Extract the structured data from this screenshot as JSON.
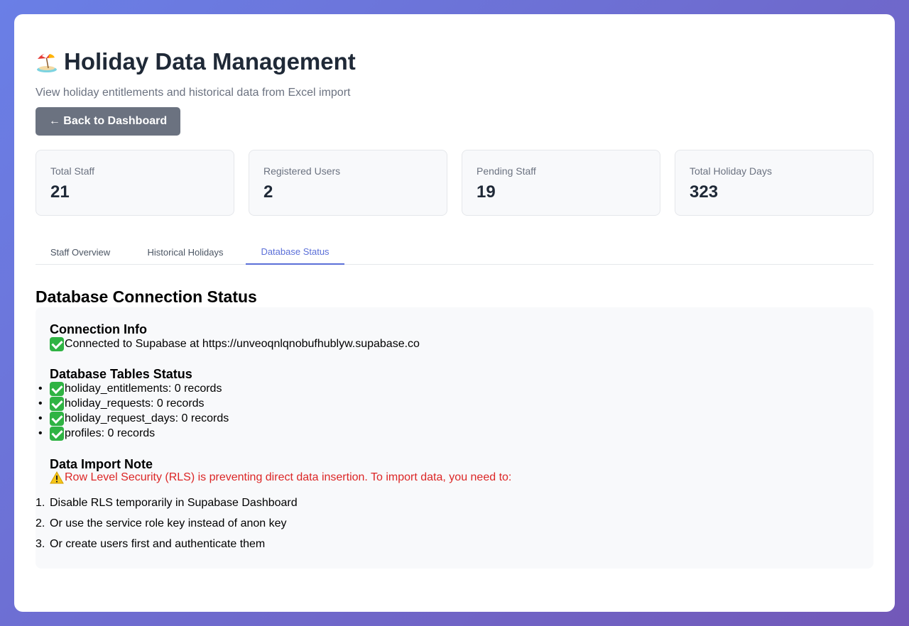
{
  "header": {
    "title": "Holiday Data Management",
    "title_icon": "beach-umbrella-icon",
    "subtitle": "View holiday entitlements and historical data from Excel import"
  },
  "back_button": {
    "label": "← Back to Dashboard"
  },
  "stats": [
    {
      "label": "Total Staff",
      "value": "21"
    },
    {
      "label": "Registered Users",
      "value": "2"
    },
    {
      "label": "Pending Staff",
      "value": "19"
    },
    {
      "label": "Total Holiday Days",
      "value": "323"
    }
  ],
  "tabs": [
    {
      "label": "Staff Overview",
      "active": false
    },
    {
      "label": "Historical Holidays",
      "active": false
    },
    {
      "label": "Database Status",
      "active": true
    }
  ],
  "section": {
    "title": "Database Connection Status",
    "connection": {
      "heading": "Connection Info",
      "text": "Connected to Supabase at https://unveoqnlqnobufhublyw.supabase.co",
      "icon": "check-icon"
    },
    "tables": {
      "heading": "Database Tables Status",
      "items": [
        "holiday_entitlements: 0 records",
        "holiday_requests: 0 records",
        "holiday_request_days: 0 records",
        "profiles: 0 records"
      ]
    },
    "import_note": {
      "heading": "Data Import Note",
      "warning": "Row Level Security (RLS) is preventing direct data insertion. To import data, you need to:",
      "warning_color": "#dc2626",
      "steps": [
        "Disable RLS temporarily in Supabase Dashboard",
        "Or use the service role key instead of anon key",
        "Or create users first and authenticate them"
      ]
    }
  },
  "colors": {
    "accent": "#5b6fd8",
    "button": "#6b7280",
    "success": "#2fb344"
  }
}
